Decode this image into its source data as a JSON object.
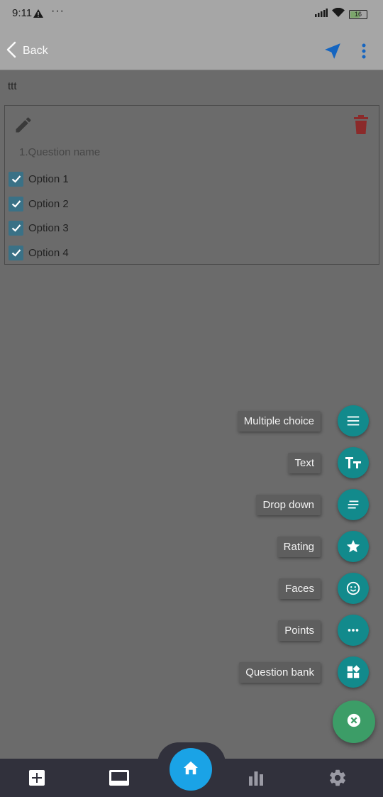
{
  "status_bar": {
    "time": "9:11",
    "dots": "···",
    "battery_level": "16",
    "icons": [
      "warning-icon",
      "signal-icon",
      "wifi-icon",
      "battery-icon"
    ]
  },
  "app_bar": {
    "back_label": "Back",
    "icons": [
      "chevron-left-icon",
      "send-icon",
      "more-vertical-icon"
    ],
    "accent_color": "#1565c0"
  },
  "survey": {
    "title": "ttt"
  },
  "question": {
    "name": "1.Question name",
    "options": [
      {
        "label": "Option 1",
        "checked": true
      },
      {
        "label": "Option 2",
        "checked": true
      },
      {
        "label": "Option 3",
        "checked": true
      },
      {
        "label": "Option 4",
        "checked": true
      }
    ],
    "icons": [
      "pencil-icon",
      "trash-icon"
    ],
    "delete_color": "#8b2a2a"
  },
  "fab_menu": {
    "items": [
      {
        "label": "Multiple choice",
        "icon": "list-icon"
      },
      {
        "label": "Text",
        "icon": "text-format-icon"
      },
      {
        "label": "Drop down",
        "icon": "short-text-icon"
      },
      {
        "label": "Rating",
        "icon": "star-icon"
      },
      {
        "label": "Faces",
        "icon": "smiley-icon"
      },
      {
        "label": "Points",
        "icon": "dots-horizontal-icon"
      },
      {
        "label": "Question bank",
        "icon": "widgets-icon"
      }
    ],
    "mini_color": "#128a8c",
    "main_color": "#3c9d67",
    "main_icon": "close-circle-icon"
  },
  "bottom_nav": {
    "items": [
      "add-box-icon",
      "subtitles-icon",
      "home-icon",
      "bar-chart-icon",
      "gear-icon"
    ],
    "home_color": "#1aa3e6"
  }
}
